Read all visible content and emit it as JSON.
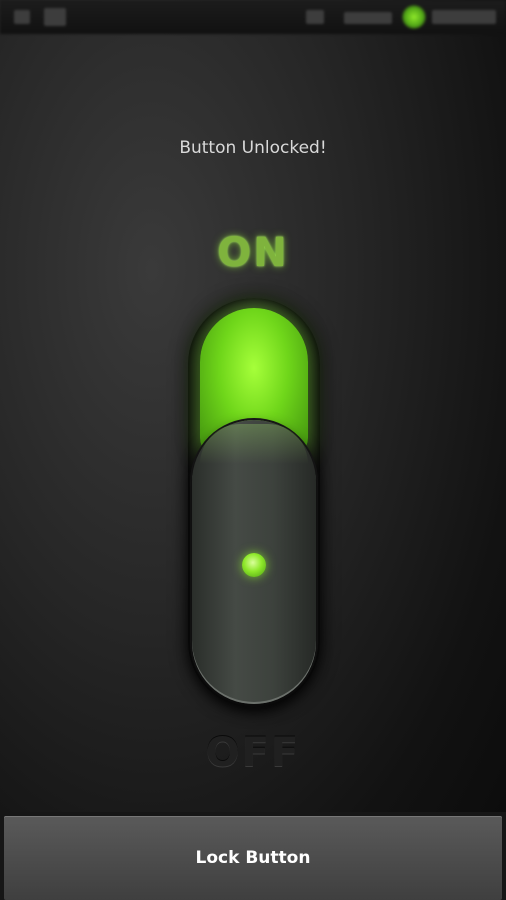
{
  "status": {
    "left_icons": [
      "usb-icon",
      "image-icon"
    ],
    "right_icons": [
      "signal-icon",
      "wifi-icon",
      "battery-icon"
    ]
  },
  "message": "Button Unlocked!",
  "switch": {
    "on_label": "ON",
    "off_label": "OFF",
    "state": "on",
    "accent_color": "#7ee020"
  },
  "lock_button_label": "Lock Button"
}
